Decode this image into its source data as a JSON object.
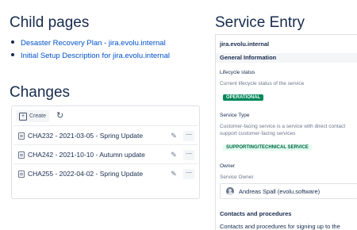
{
  "child_pages": {
    "title": "Child pages",
    "items": [
      {
        "label": "Desaster Recovery Plan - jira.evolu.internal"
      },
      {
        "label": "Initial Setup Description for jira.evolu.internal"
      }
    ]
  },
  "changes": {
    "title": "Changes",
    "create_label": "Create",
    "rows": [
      {
        "label": "CHA232 - 2021-03-05 - Spring Update"
      },
      {
        "label": "CHA242 - 2021-10-10 - Autumn update"
      },
      {
        "label": "CHA255 - 2022-04-02 - Spring Update"
      }
    ]
  },
  "service_entry": {
    "title": "Service Entry",
    "host": "jira.evolu.internal",
    "general_section": "General Information",
    "lifecycle": {
      "label": "Lifecycle status",
      "description": "Current lifecycle status of the service",
      "value": "OPERATIONAL"
    },
    "service_type": {
      "label": "Service Type",
      "description_line1": "Customer-facing service is a service with direct contact",
      "description_line2": "support customer-facing services",
      "value": "SUPPORTING/TECHNICAL SERVICE"
    },
    "owner": {
      "label": "Owner",
      "description": "Service Owner",
      "name": "Andreas Spall (evolu.software)"
    },
    "contacts_section": "Contacts and procedures",
    "contacts_text": "Contacts and procedures for signing up to the"
  },
  "colors": {
    "link": "#0052cc",
    "operational_badge": "#00875a",
    "supporting_badge_bg": "#e3fcef",
    "supporting_badge_text": "#006644"
  },
  "icons": [
    "document-icon",
    "edit-icon",
    "more-icon",
    "refresh-icon",
    "plus-icon",
    "avatar-icon"
  ]
}
